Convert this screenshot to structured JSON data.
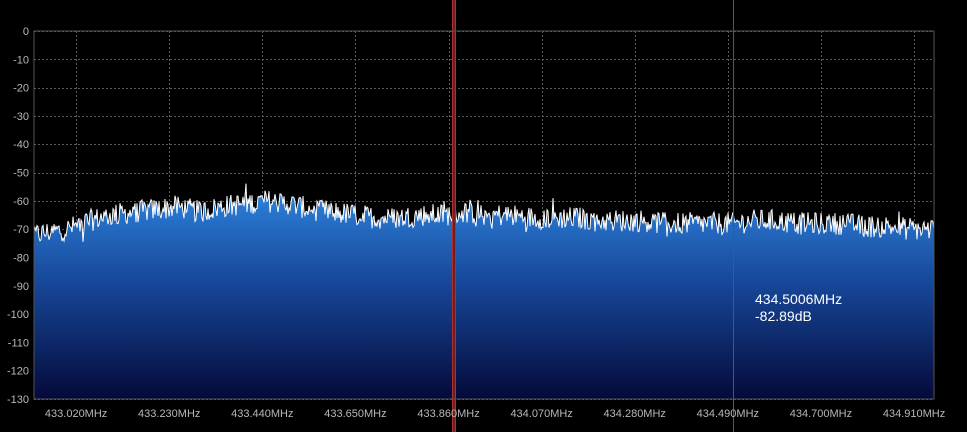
{
  "chart_data": {
    "type": "area",
    "title": "",
    "xlabel": "",
    "ylabel": "",
    "x_unit": "MHz",
    "y_unit": "dB",
    "xlim": [
      432.925,
      434.955
    ],
    "ylim": [
      -130,
      0
    ],
    "grid": true,
    "y_ticks": [
      0,
      -10,
      -20,
      -30,
      -40,
      -50,
      -60,
      -70,
      -80,
      -90,
      -100,
      -110,
      -120,
      -130
    ],
    "y_tick_labels": [
      "0",
      "-10",
      "-20",
      "-30",
      "-40",
      "-50",
      "-60",
      "-70",
      "-80",
      "-90",
      "-100",
      "-110",
      "-120",
      "-130"
    ],
    "x_ticks": [
      433.02,
      433.23,
      433.44,
      433.65,
      433.86,
      434.07,
      434.28,
      434.49,
      434.7,
      434.91
    ],
    "x_tick_labels": [
      "433.020MHz",
      "433.230MHz",
      "433.440MHz",
      "433.650MHz",
      "433.860MHz",
      "434.070MHz",
      "434.280MHz",
      "434.490MHz",
      "434.700MHz",
      "434.910MHz"
    ],
    "series": [
      {
        "x": [
          432.925,
          433.0,
          433.05,
          433.1,
          433.15,
          433.2,
          433.25,
          433.3,
          433.35,
          433.4,
          433.45,
          433.5,
          433.55,
          433.6,
          433.65,
          433.7,
          433.75,
          433.8,
          433.85,
          433.9,
          433.95,
          434.0,
          434.05,
          434.1,
          434.15,
          434.2,
          434.25,
          434.3,
          434.35,
          434.4,
          434.45,
          434.5,
          434.55,
          434.6,
          434.65,
          434.7,
          434.75,
          434.8,
          434.85,
          434.9,
          434.955
        ],
        "y": [
          -72,
          -70,
          -67,
          -65,
          -64,
          -63,
          -62,
          -64,
          -62,
          -61,
          -60,
          -61,
          -63,
          -64,
          -65,
          -66,
          -66,
          -65,
          -65,
          -64,
          -65,
          -65,
          -66,
          -66,
          -66,
          -67,
          -67,
          -67,
          -68,
          -68,
          -68,
          -68,
          -67,
          -67,
          -68,
          -68,
          -68,
          -69,
          -69,
          -70,
          -70
        ]
      }
    ],
    "markers": [
      {
        "frequency_mhz": 433.87,
        "color": "#b03030"
      },
      {
        "frequency_mhz": 434.5006,
        "color": "#b03030"
      }
    ],
    "cursor_readout": {
      "frequency": "434.5006MHz",
      "level": "-82.89dB"
    }
  },
  "colors": {
    "background": "#000000",
    "grid": "#5a5a5a",
    "trace": "#ffffff",
    "fill_top": "#2f86e0",
    "fill_bottom": "#050a3a",
    "marker": "#b03030",
    "tick_text": "#b8b8b8"
  }
}
